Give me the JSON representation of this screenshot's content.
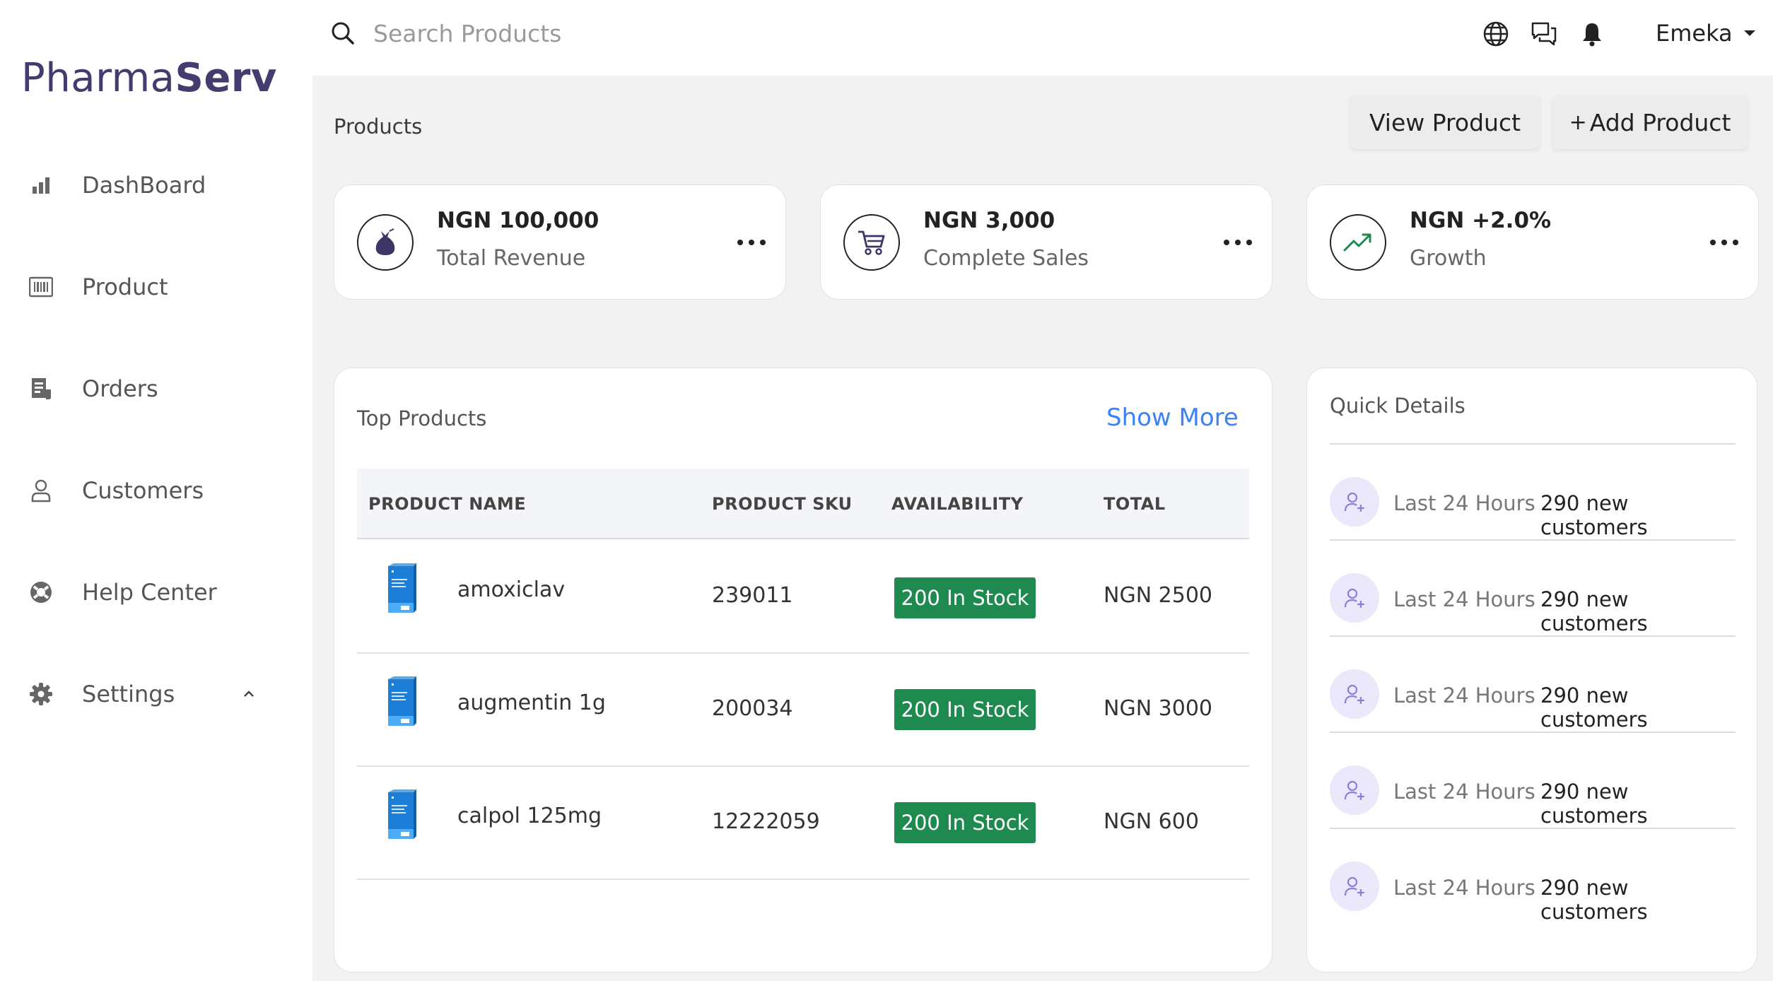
{
  "brand": {
    "name_light": "Pharma",
    "name_bold": "Serv",
    "color": "#443c6e"
  },
  "sidebar": {
    "items": [
      {
        "label": "DashBoard",
        "icon": "bar-chart-icon"
      },
      {
        "label": "Product",
        "icon": "barcode-icon"
      },
      {
        "label": "Orders",
        "icon": "document-icon"
      },
      {
        "label": "Customers",
        "icon": "user-icon"
      },
      {
        "label": "Help Center",
        "icon": "lifebuoy-icon"
      },
      {
        "label": "Settings",
        "icon": "gear-icon",
        "expanded": true
      }
    ]
  },
  "topbar": {
    "search_placeholder": "Search Products",
    "search_value": "",
    "icons": [
      "globe-icon",
      "chat-icon",
      "bell-icon"
    ],
    "user_name": "Emeka"
  },
  "page": {
    "title": "Products",
    "view_button": "View Product",
    "add_button_plus": "+",
    "add_button": "Add Product"
  },
  "stats": [
    {
      "value": "NGN 100,000",
      "label": "Total Revenue",
      "icon": "money-bag-icon"
    },
    {
      "value": "NGN 3,000",
      "label": "Complete Sales",
      "icon": "cart-icon"
    },
    {
      "value": "NGN +2.0%",
      "label": "Growth",
      "icon": "trending-up-icon"
    }
  ],
  "top_products": {
    "title": "Top Products",
    "show_more": "Show More",
    "columns": [
      "PRODUCT NAME",
      "PRODUCT SKU",
      "AVAILABILITY",
      "TOTAL"
    ],
    "rows": [
      {
        "name": "amoxiclav",
        "sku": "239011",
        "availability": "200 In Stock",
        "total": "NGN 2500"
      },
      {
        "name": "augmentin 1g",
        "sku": "200034",
        "availability": "200 In Stock",
        "total": "NGN 3000"
      },
      {
        "name": "calpol 125mg",
        "sku": "12222059",
        "availability": "200 In Stock",
        "total": "NGN 600"
      }
    ]
  },
  "quick_details": {
    "title": "Quick Details",
    "rows": [
      {
        "label": "Last 24 Hours",
        "value": "290 new customers"
      },
      {
        "label": "Last 24 Hours",
        "value": "290 new customers"
      },
      {
        "label": "Last 24 Hours",
        "value": "290 new customers"
      },
      {
        "label": "Last 24 Hours",
        "value": "290 new customers"
      },
      {
        "label": "Last 24 Hours",
        "value": "290 new customers"
      }
    ]
  },
  "colors": {
    "stock_badge": "#1e8a4f",
    "link": "#3b82f6",
    "avatar_bg": "#ebe8fb",
    "avatar_icon": "#8b7fd6",
    "growth_icon": "#1e8a4f"
  }
}
